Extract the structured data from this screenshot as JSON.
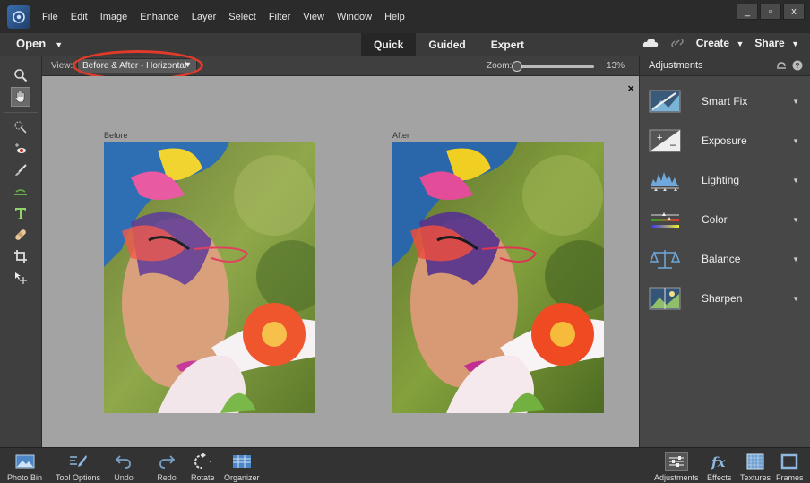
{
  "menu": {
    "items": [
      "File",
      "Edit",
      "Image",
      "Enhance",
      "Layer",
      "Select",
      "Filter",
      "View",
      "Window",
      "Help"
    ]
  },
  "window_controls": {
    "minimize": "_",
    "maximize": "▫",
    "close": "x"
  },
  "modebar": {
    "open_label": "Open",
    "tabs": [
      {
        "label": "Quick",
        "active": true
      },
      {
        "label": "Guided",
        "active": false
      },
      {
        "label": "Expert",
        "active": false
      }
    ],
    "create_label": "Create",
    "share_label": "Share"
  },
  "options": {
    "view_label": "View:",
    "view_value": "Before & After - Horizontal",
    "zoom_label": "Zoom:",
    "zoom_value": "13%",
    "zoom_level_percent": 13
  },
  "canvas": {
    "close_symbol": "×",
    "before_label": "Before",
    "after_label": "After",
    "background": "#a3a3a3"
  },
  "tools": [
    {
      "name": "zoom-tool",
      "icon": "magnifier-icon",
      "selected": false
    },
    {
      "name": "hand-tool",
      "icon": "hand-icon",
      "selected": true
    },
    {
      "name": "quick-selection-tool",
      "icon": "quick-selection-icon",
      "selected": false
    },
    {
      "name": "red-eye-tool",
      "icon": "eye-icon",
      "selected": false
    },
    {
      "name": "whiten-teeth-tool",
      "icon": "brush-icon",
      "selected": false
    },
    {
      "name": "straighten-tool",
      "icon": "straighten-icon",
      "selected": false
    },
    {
      "name": "type-tool",
      "icon": "type-icon",
      "selected": false
    },
    {
      "name": "spot-healing-tool",
      "icon": "bandage-icon",
      "selected": false
    },
    {
      "name": "crop-tool",
      "icon": "crop-icon",
      "selected": false
    },
    {
      "name": "move-tool",
      "icon": "move-icon",
      "selected": false
    }
  ],
  "panel": {
    "title": "Adjustments",
    "items": [
      {
        "label": "Smart Fix",
        "icon": "smart-fix-icon"
      },
      {
        "label": "Exposure",
        "icon": "exposure-icon"
      },
      {
        "label": "Lighting",
        "icon": "lighting-icon"
      },
      {
        "label": "Color",
        "icon": "color-icon"
      },
      {
        "label": "Balance",
        "icon": "balance-icon"
      },
      {
        "label": "Sharpen",
        "icon": "sharpen-icon"
      }
    ]
  },
  "bottom_left": [
    {
      "label": "Photo Bin",
      "icon": "photo-bin-icon"
    },
    {
      "label": "Tool Options",
      "icon": "tool-options-icon"
    },
    {
      "label": "Undo",
      "icon": "undo-icon"
    },
    {
      "label": "Redo",
      "icon": "redo-icon"
    },
    {
      "label": "Rotate",
      "icon": "rotate-icon"
    },
    {
      "label": "Organizer",
      "icon": "organizer-icon"
    }
  ],
  "bottom_right": [
    {
      "label": "Adjustments",
      "icon": "adjustments-icon"
    },
    {
      "label": "Effects",
      "icon": "effects-icon"
    },
    {
      "label": "Textures",
      "icon": "textures-icon"
    },
    {
      "label": "Frames",
      "icon": "frames-icon"
    }
  ],
  "colors": {
    "highlight": "#e03a2a",
    "menubar": "#2b2b2b",
    "panel": "#474747"
  }
}
